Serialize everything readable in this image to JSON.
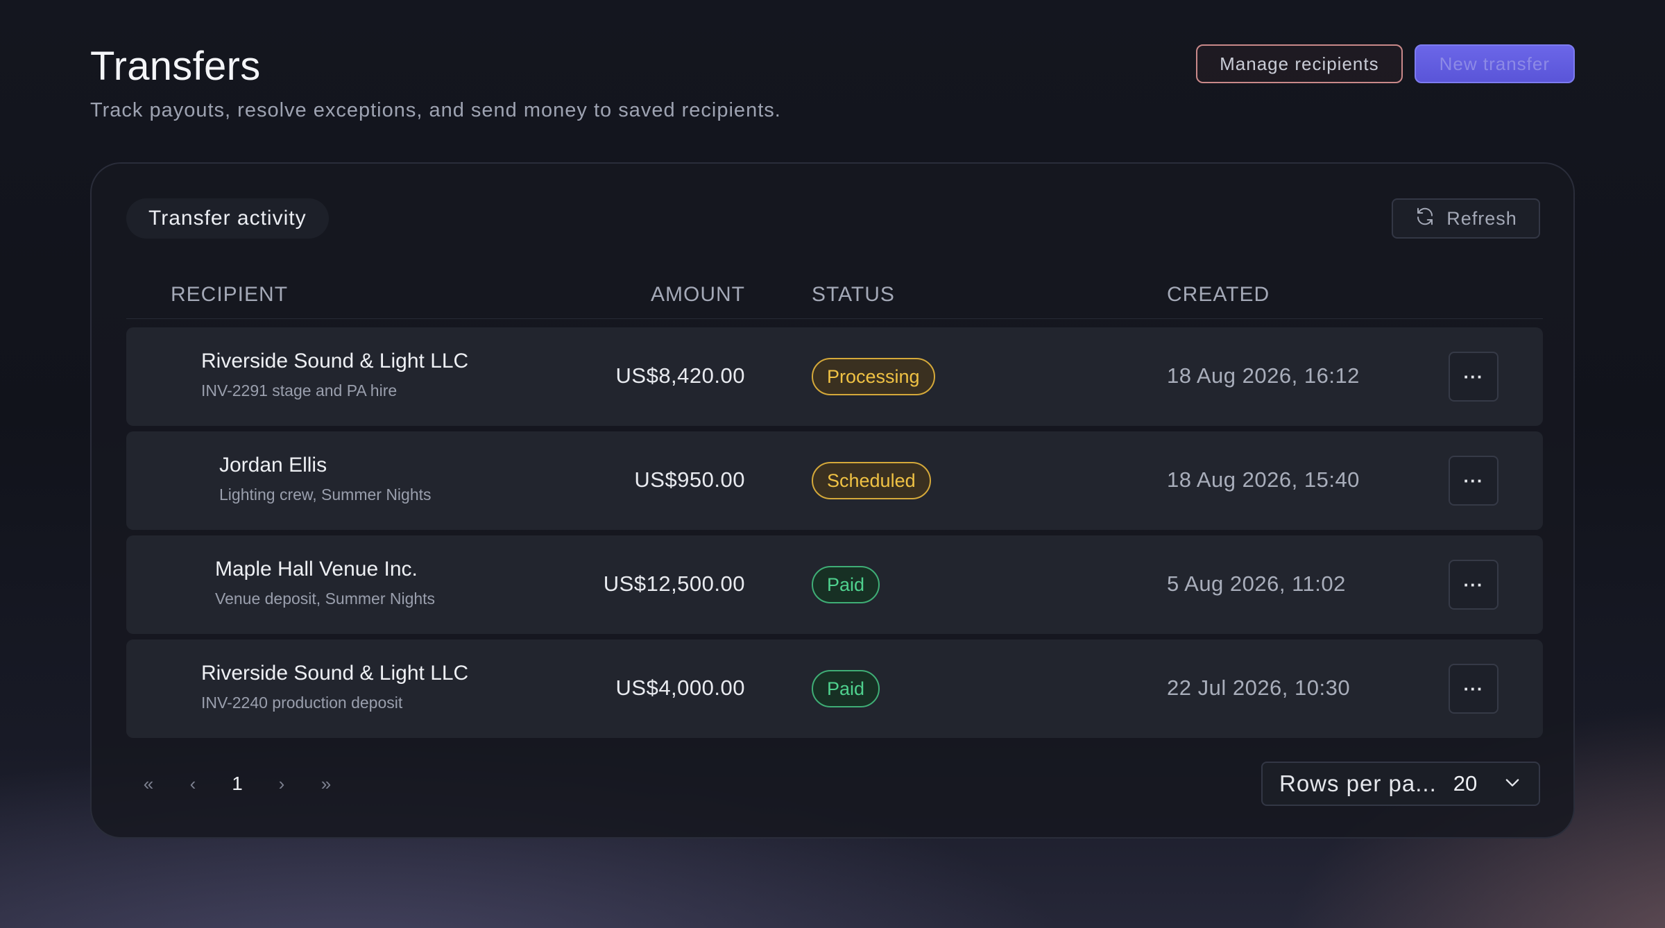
{
  "header": {
    "title": "Transfers",
    "subtitle": "Track payouts, resolve exceptions, and send money to saved recipients.",
    "manage_label": "Manage recipients",
    "new_label": "New transfer"
  },
  "card": {
    "title": "Transfer activity",
    "refresh_label": "Refresh",
    "refresh_icon": "refresh-icon"
  },
  "table": {
    "columns": [
      "RECIPIENT",
      "AMOUNT",
      "STATUS",
      "CREATED"
    ],
    "rows": [
      {
        "name": "Riverside Sound & Light LLC",
        "sub": "INV-2291 stage and PA hire",
        "amount": "US$8,420.00",
        "status": "Processing",
        "status_kind": "warn",
        "created": "18 Aug 2026, 16:12",
        "action": "···"
      },
      {
        "name": "Jordan Ellis",
        "sub": "Lighting crew, Summer Nights",
        "amount": "US$950.00",
        "status": "Scheduled",
        "status_kind": "warn",
        "created": "18 Aug 2026, 15:40",
        "action": "···"
      },
      {
        "name": "Maple Hall Venue Inc.",
        "sub": "Venue deposit, Summer Nights",
        "amount": "US$12,500.00",
        "status": "Paid",
        "status_kind": "ok",
        "created": "5 Aug 2026, 11:02",
        "action": "···"
      },
      {
        "name": "Riverside Sound & Light LLC",
        "sub": "INV-2240 production deposit",
        "amount": "US$4,000.00",
        "status": "Paid",
        "status_kind": "ok",
        "created": "22 Jul 2026, 10:30",
        "action": "···"
      }
    ]
  },
  "pagination": {
    "first": "«",
    "prev": "‹",
    "current_page": "1",
    "next": "›",
    "last": "»"
  },
  "rows_per_page": {
    "label": "Rows per pa...",
    "value": "20"
  },
  "colors": {
    "warn": "#f0c244",
    "ok": "#4fd18e",
    "primary": "#6b66e8"
  }
}
